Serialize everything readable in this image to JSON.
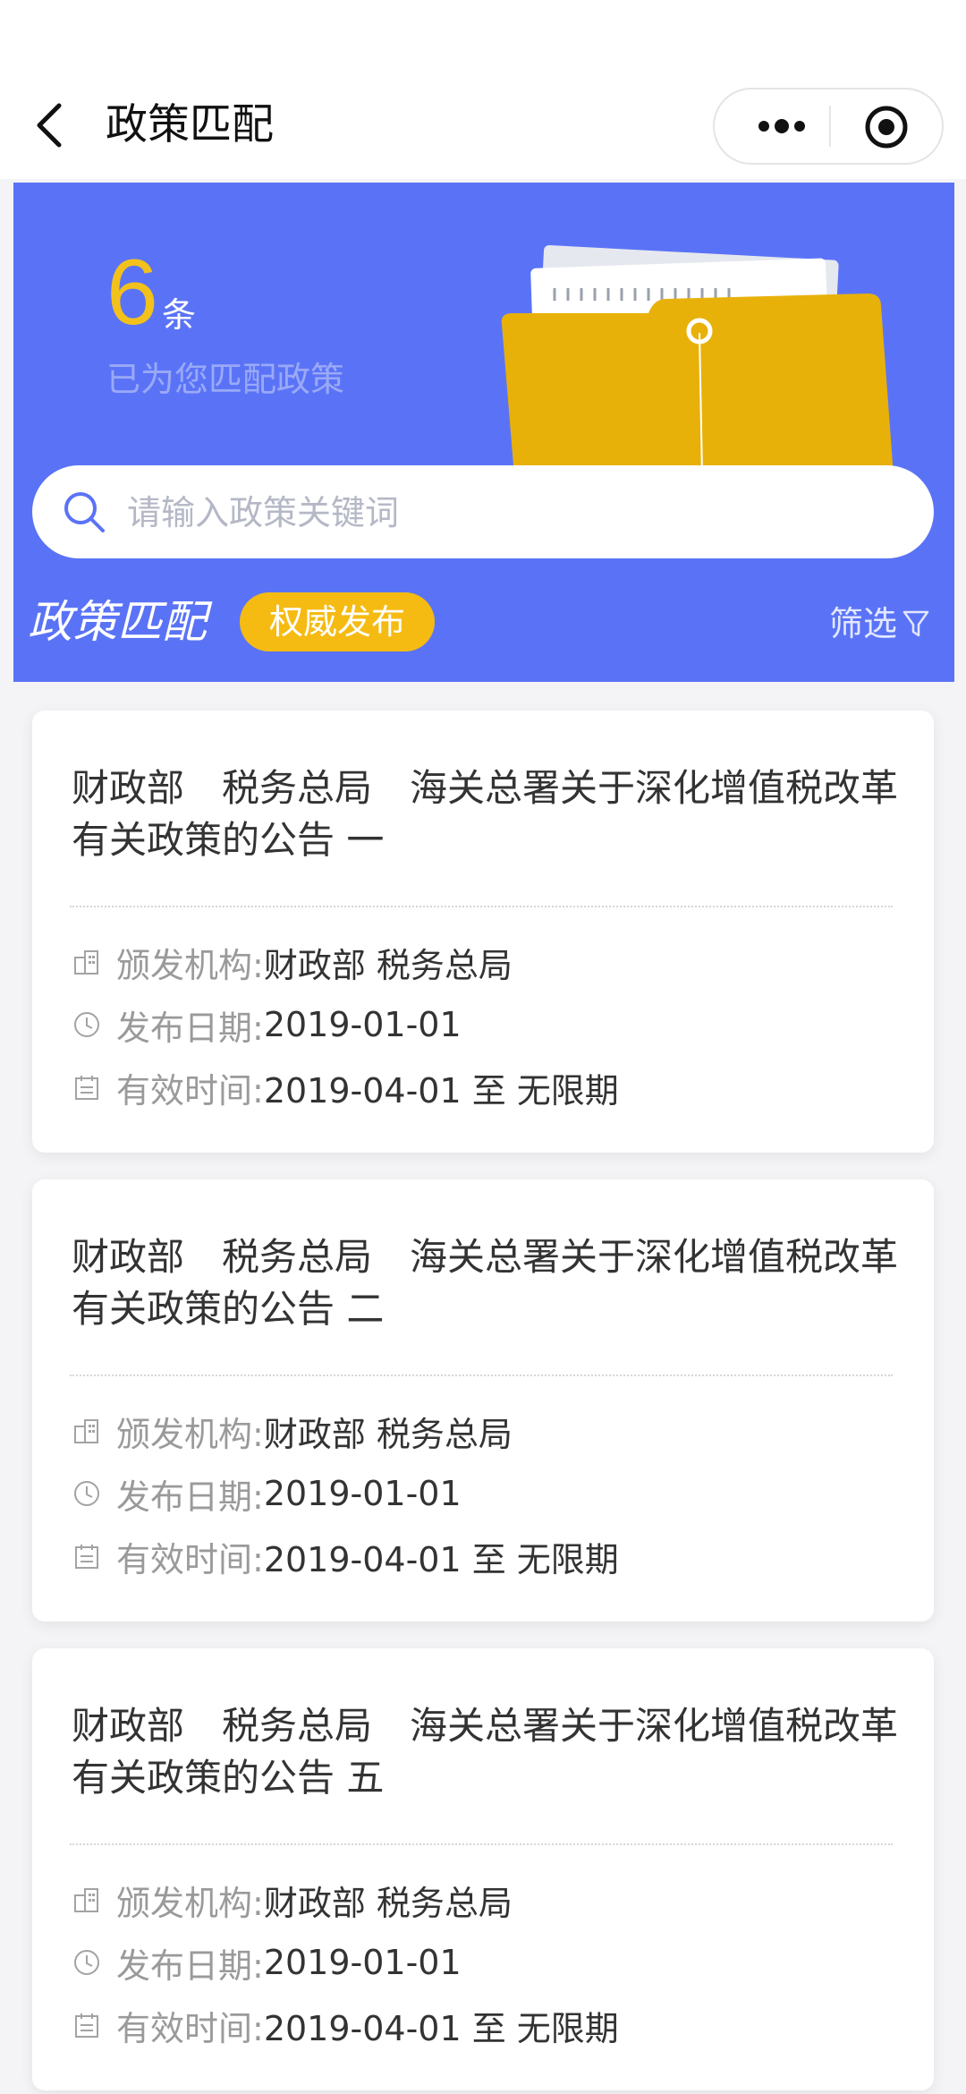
{
  "nav": {
    "title": "政策匹配"
  },
  "summary": {
    "count": "6",
    "unit": "条",
    "desc": "已为您匹配政策"
  },
  "search": {
    "placeholder": "请输入政策关键词"
  },
  "section": {
    "title": "政策匹配",
    "badge": "权威发布",
    "filter_label": "筛选"
  },
  "labels": {
    "issuer": "颁发机构:",
    "date": "发布日期:",
    "valid": "有效时间:"
  },
  "policies": [
    {
      "title": "财政部　税务总局　海关总署关于深化增值税改革有关政策的公告 一",
      "issuer": "财政部 税务总局",
      "date": "2019-01-01",
      "valid": "2019-04-01 至 无限期"
    },
    {
      "title": "财政部　税务总局　海关总署关于深化增值税改革有关政策的公告 二",
      "issuer": "财政部 税务总局",
      "date": "2019-01-01",
      "valid": "2019-04-01 至 无限期"
    },
    {
      "title": "财政部　税务总局　海关总署关于深化增值税改革有关政策的公告 五",
      "issuer": "财政部 税务总局",
      "date": "2019-01-01",
      "valid": "2019-04-01 至 无限期"
    }
  ],
  "colors": {
    "banner": "#5a73f6",
    "accent_yellow": "#f5bb12",
    "count_yellow": "#f3c11b"
  }
}
